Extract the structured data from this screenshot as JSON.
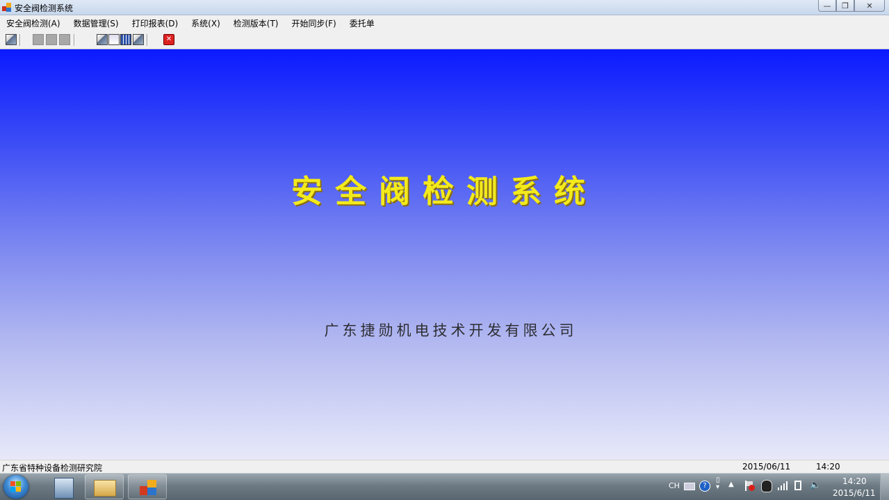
{
  "window": {
    "title": "安全阀检测系统",
    "min_symbol": "—",
    "max_symbol": "❐",
    "close_symbol": "✕"
  },
  "menu": {
    "items": [
      {
        "label": "安全阀检测(A)"
      },
      {
        "label": "数据管理(S)"
      },
      {
        "label": "打印报表(D)"
      },
      {
        "label": "系统(X)"
      },
      {
        "label": "检测版本(T)"
      },
      {
        "label": "开始同步(F)"
      },
      {
        "label": "委托单"
      }
    ]
  },
  "toolbar": {
    "icons": [
      "open-picture-icon",
      "grey-button-icon",
      "grey-button-icon",
      "grey-button-icon",
      "chart-icon",
      "grid-icon",
      "table-icon",
      "image-icon",
      "exit-icon"
    ]
  },
  "main": {
    "title": "安全阀检测系统",
    "company": "广东捷勋机电技术开发有限公司",
    "colors": {
      "top": "#0b1aff",
      "bottom": "#e7e9f9",
      "title": "#f3ea1c"
    }
  },
  "statusbar": {
    "organization": "广东省特种设备检测研究院",
    "date": "2015/06/11",
    "time": "14:20"
  },
  "taskbar": {
    "tray_lang": "CH",
    "clock_time": "14:20",
    "clock_date": "2015/6/11",
    "tray_icons": [
      "keyboard-icon",
      "help-icon",
      "pen-icon",
      "show-hidden-icon",
      "action-center-icon",
      "qq-icon",
      "network-icon",
      "device-icon",
      "volume-icon"
    ]
  }
}
